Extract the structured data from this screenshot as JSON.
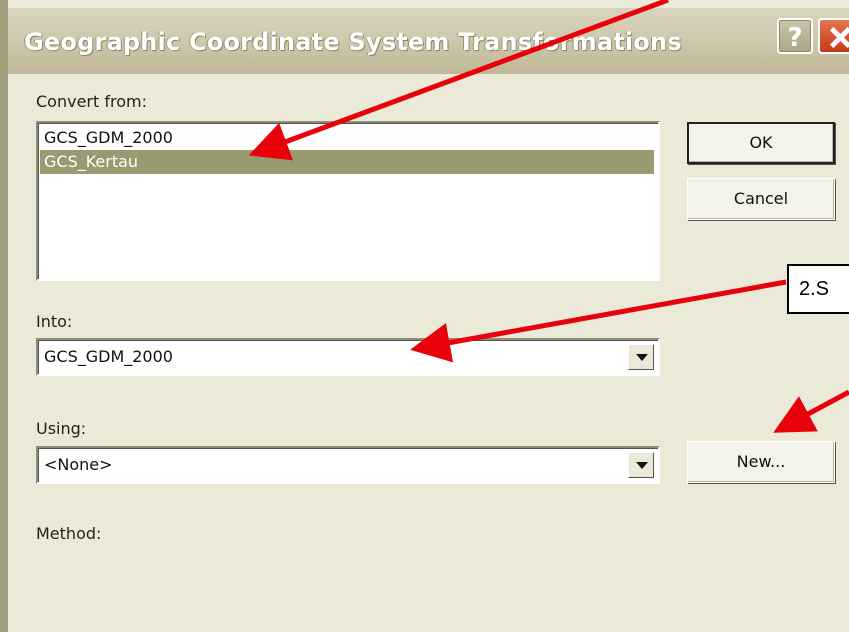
{
  "dialog": {
    "title": "Geographic Coordinate System Transformations",
    "help_label": "?",
    "close_label": "close"
  },
  "convert_from": {
    "label": "Convert from:",
    "items": [
      {
        "label": "GCS_GDM_2000",
        "selected": false
      },
      {
        "label": "GCS_Kertau",
        "selected": true
      }
    ]
  },
  "into": {
    "label": "Into:",
    "value": "GCS_GDM_2000"
  },
  "using": {
    "label": "Using:",
    "value": "<None>"
  },
  "method": {
    "label": "Method:"
  },
  "buttons": {
    "ok": "OK",
    "cancel": "Cancel",
    "new": "New..."
  },
  "annotations": {
    "callout_text": "2.S",
    "arrow_color": "#e8000b"
  },
  "colors": {
    "selection": "#999a6f",
    "dialog_bg": "#ebe9d8",
    "titlebar": "#cfc9ae",
    "close": "#c8391a"
  }
}
